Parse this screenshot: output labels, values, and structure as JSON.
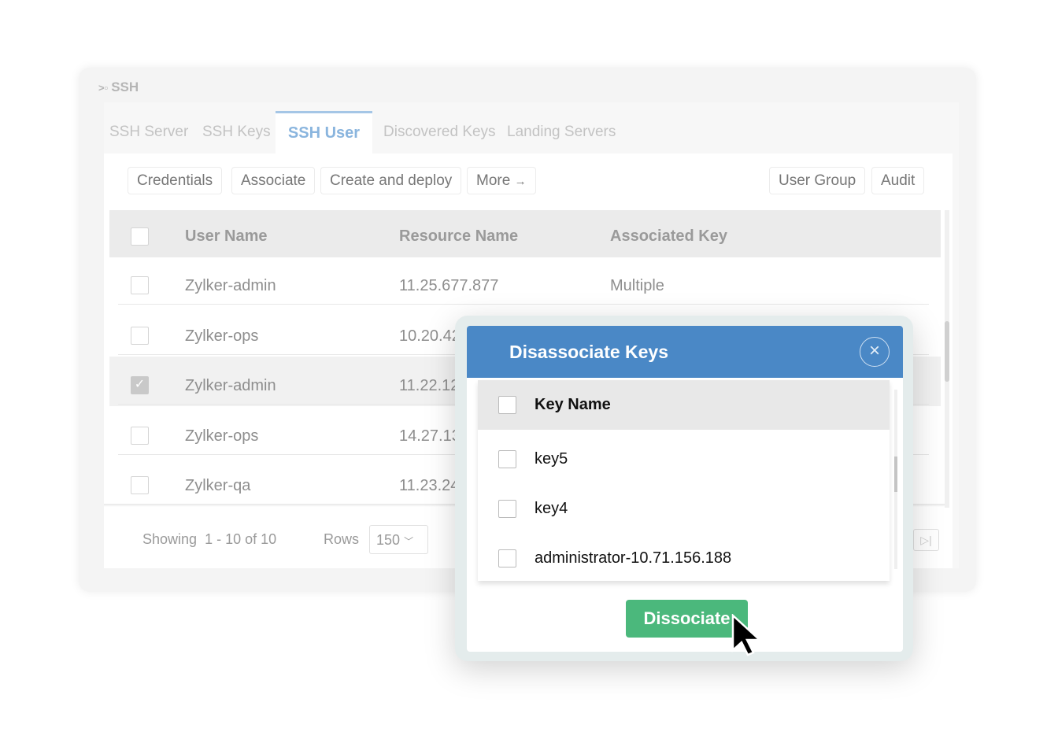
{
  "app": {
    "title": "SSH",
    "icon": "terminal-icon"
  },
  "tabs": [
    "SSH Server",
    "SSH Keys",
    "SSH User",
    "Discovered Keys",
    "Landing Servers"
  ],
  "toolbar": {
    "credentials": "Credentials",
    "associate": "Associate",
    "create_deploy": "Create and deploy",
    "more": "More",
    "more_icon": "→",
    "user_group": "User Group",
    "audit": "Audit"
  },
  "table": {
    "headers": [
      "User Name",
      "Resource Name",
      "Associated Key"
    ],
    "rows": [
      {
        "user": "Zylker-admin",
        "resource": "11.25.677.877",
        "key": "Multiple",
        "checked": false
      },
      {
        "user": "Zylker-ops",
        "resource": "10.20.42",
        "key": "",
        "checked": false
      },
      {
        "user": "Zylker-admin",
        "resource": "11.22.12",
        "key": "",
        "checked": true
      },
      {
        "user": "Zylker-ops",
        "resource": "14.27.13",
        "key": "",
        "checked": false
      },
      {
        "user": "Zylker-qa",
        "resource": "11.23.24",
        "key": "",
        "checked": false
      }
    ]
  },
  "footer": {
    "showing_label": "Showing",
    "range": "1 - 10 of 10",
    "rows_label": "Rows",
    "rows_value": "150"
  },
  "modal": {
    "title": "Disassociate Keys",
    "close": "×",
    "header": "Key Name",
    "keys": [
      "key5",
      "key4",
      "administrator-10.71.156.188"
    ],
    "button": "Dissociate"
  },
  "colors": {
    "modal_header": "#4a88c6",
    "button": "#4bb87c",
    "active_tab": "#8ab5de"
  }
}
